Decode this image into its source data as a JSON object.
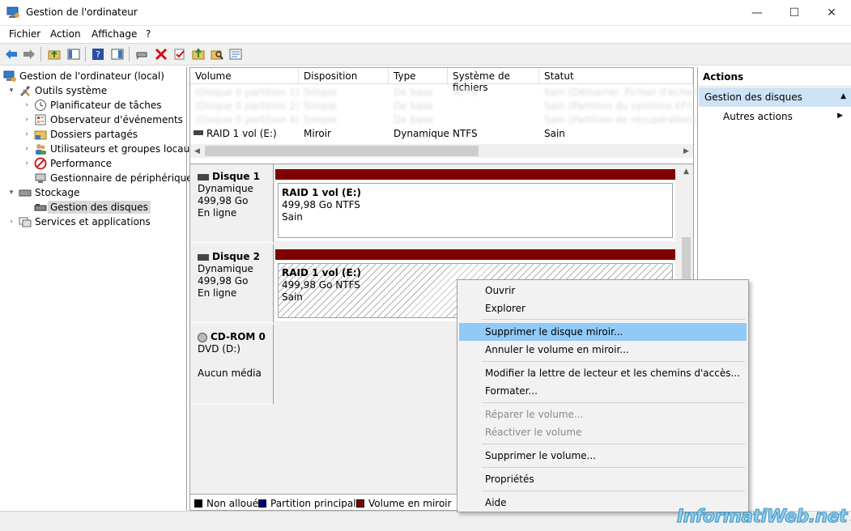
{
  "window": {
    "title": "Gestion de l'ordinateur",
    "minimize": "—",
    "maximize": "☐",
    "close": "✕"
  },
  "menu": [
    "Fichier",
    "Action",
    "Affichage",
    "?"
  ],
  "tree": {
    "root": "Gestion de l'ordinateur (local)",
    "system_tools": "Outils système",
    "task_scheduler": "Planificateur de tâches",
    "event_viewer": "Observateur d'événements",
    "shared_folders": "Dossiers partagés",
    "local_users": "Utilisateurs et groupes locaux",
    "performance": "Performance",
    "device_manager": "Gestionnaire de périphériques",
    "storage": "Stockage",
    "disk_management": "Gestion des disques",
    "services": "Services et applications"
  },
  "volume_list": {
    "headers": [
      "Volume",
      "Disposition",
      "Type",
      "Système de fichiers",
      "Statut"
    ],
    "blurred_rows": [
      [
        "(Disque 0 partition 1)",
        "Simple",
        "De base",
        "NTFS",
        "Sain (Démarrer, Fichier d'échange)"
      ],
      [
        "(Disque 0 partition 2)",
        "Simple",
        "De base",
        "",
        "Sain (Partition du système EFI)"
      ],
      [
        "(Disque 0 partition 4)",
        "Simple",
        "De base",
        "",
        "Sain (Partition de récupération)"
      ]
    ],
    "raid_row": {
      "volume": "RAID 1 vol (E:)",
      "layout": "Miroir",
      "type": "Dynamique",
      "fs": "NTFS",
      "status": "Sain"
    }
  },
  "disks": [
    {
      "name": "Disque 1",
      "type": "Dynamique",
      "size": "499,98 Go",
      "state": "En ligne",
      "part_name": "RAID 1 vol  (E:)",
      "part_size": "499,98 Go NTFS",
      "part_status": "Sain"
    },
    {
      "name": "Disque 2",
      "type": "Dynamique",
      "size": "499,98 Go",
      "state": "En ligne",
      "part_name": "RAID 1 vol  (E:)",
      "part_size": "499,98 Go NTFS",
      "part_status": "Sain"
    }
  ],
  "cdrom": {
    "name": "CD-ROM 0",
    "drive": "DVD (D:)",
    "media": "Aucun média"
  },
  "legend": [
    {
      "label": "Non alloué",
      "color": "#000000"
    },
    {
      "label": "Partition principale",
      "color": "#00007f"
    },
    {
      "label": "Volume en miroir",
      "color": "#7f0000"
    }
  ],
  "actions": {
    "header": "Actions",
    "section": "Gestion des disques",
    "other": "Autres actions"
  },
  "context_menu": {
    "open": "Ouvrir",
    "explore": "Explorer",
    "remove_mirror": "Supprimer le disque miroir...",
    "break_mirror": "Annuler le volume en miroir...",
    "change_letter": "Modifier la lettre de lecteur et les chemins d'accès...",
    "format": "Formater...",
    "repair": "Réparer le volume...",
    "reactivate": "Réactiver le volume",
    "delete": "Supprimer le volume...",
    "properties": "Propriétés",
    "help": "Aide"
  },
  "watermark": "InformatiWeb.net",
  "colors": {
    "mirror": "#800000",
    "highlight": "#91c9f7",
    "actions_selected": "#cfe3f7"
  }
}
